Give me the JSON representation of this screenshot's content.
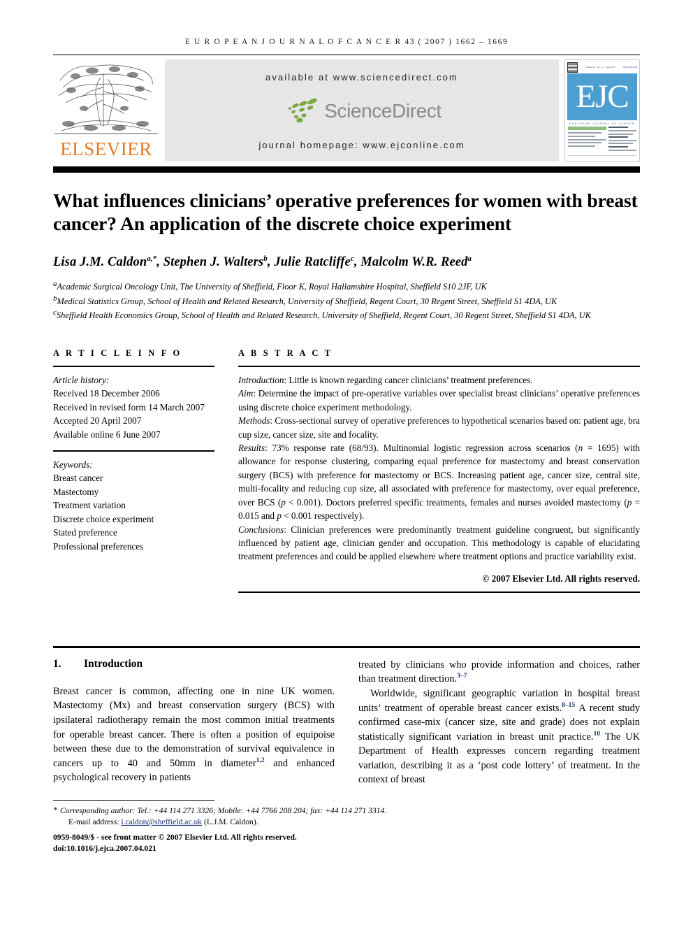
{
  "running_head": {
    "journal": "E U R O P E A N   J O U R N A L   O F   C A N C E R",
    "citation": "43 ( 2007 ) 1662 – 1669",
    "full": "EUROPEAN JOURNAL OF CANCER 43 (2007) 1662–1669"
  },
  "masthead": {
    "publisher_wordmark": "ELSEVIER",
    "available_at": "available at www.sciencedirect.com",
    "sciencedirect_logo_text": "ScienceDirect",
    "journal_homepage": "journal homepage: www.ejconline.com",
    "cover": {
      "acronym": "EJC",
      "subtitle": "EUROPEAN JOURNAL OF CANCER",
      "issue_line": "Volume 43 · No. 11 · June 2007",
      "issn_line": "ISSN 0959-8049",
      "toc_items": [
        "Prognostic markers for prostate cancer",
        "Pain relief assessment in breast",
        "Breast conserving surgery and mastectomy after rtPCR evaluation of recurrence"
      ]
    },
    "colors": {
      "elsevier_orange": "#E87722",
      "band_grey": "#e6e6e6",
      "sciencedirect_green": "#7aa843",
      "sciencedirect_grey": "#8a8a8a",
      "cover_blue": "#4e9fd1"
    }
  },
  "article": {
    "title": "What influences clinicians’ operative preferences for women with breast cancer? An application of the discrete choice experiment",
    "authors_html": "Lisa J.M. Caldon<sup>a,</sup><sup>*</sup>, Stephen J. Walters<sup>b</sup>, Julie Ratcliffe<sup>c</sup>, Malcolm W.R. Reed<sup>a</sup>",
    "affiliations": [
      "Academic Surgical Oncology Unit, The University of Sheffield, Floor K, Royal Hallamshire Hospital, Sheffield S10 2JF, UK",
      "Medical Statistics Group, School of Health and Related Research, University of Sheffield, Regent Court, 30 Regent Street, Sheffield S1 4DA, UK",
      "Sheffield Health Economics Group, School of Health and Related Research, University of Sheffield, Regent Court, 30 Regent Street, Sheffield S1 4DA, UK"
    ],
    "affiliation_markers": [
      "a",
      "b",
      "c"
    ]
  },
  "article_info": {
    "heading": "A R T I C L E   I N F O",
    "history_label": "Article history:",
    "history": [
      "Received 18 December 2006",
      "Received in revised form 14 March 2007",
      "Accepted 20 April 2007",
      "Available online 6 June 2007"
    ],
    "keywords_label": "Keywords:",
    "keywords": [
      "Breast cancer",
      "Mastectomy",
      "Treatment variation",
      "Discrete choice experiment",
      "Stated preference",
      "Professional preferences"
    ]
  },
  "abstract": {
    "heading": "A B S T R A C T",
    "sections": [
      {
        "label": "Introduction",
        "text": "Little is known regarding cancer clinicians’ treatment preferences."
      },
      {
        "label": "Aim",
        "text": "Determine the impact of pre-operative variables over specialist breast clinicians’ operative preferences using discrete choice experiment methodology."
      },
      {
        "label": "Methods",
        "text": "Cross-sectional survey of operative preferences to hypothetical scenarios based on: patient age, bra cup size, cancer size, site and focality."
      },
      {
        "label": "Results",
        "text_html": "73% response rate (68/93). Multinomial logistic regression across scenarios (<i>n</i> = 1695) with allowance for response clustering, comparing equal preference for mastectomy and breast conservation surgery (BCS) with preference for mastectomy or BCS. Increasing patient age, cancer size, central site, multi-focality and reducing cup size, all associated with preference for mastectomy, over equal preference, over BCS (<i>p</i> &lt; 0.001). Doctors preferred specific treatments, females and nurses avoided mastectomy (<i>p</i> = 0.015 and <i>p</i> &lt; 0.001 respectively)."
      },
      {
        "label": "Conclusions",
        "text": "Clinician preferences were predominantly treatment guideline congruent, but significantly influenced by patient age, clinician gender and occupation. This methodology is capable of elucidating treatment preferences and could be applied elsewhere where treatment options and practice variability exist."
      }
    ],
    "copyright": "© 2007 Elsevier Ltd. All rights reserved."
  },
  "body": {
    "section_number": "1.",
    "section_title": "Introduction",
    "left_column_html": "Breast cancer is common, affecting one in nine UK women. Mastectomy (Mx) and breast conservation surgery (BCS) with ipsilateral radiotherapy remain the most common initial treatments for operable breast cancer. There is often a position of equipoise between these due to the demonstration of survival equivalence in cancers up to 40 and 50mm in diameter<sup>1,2</sup> and enhanced psychological recovery in patients",
    "right_column_para1_html": "treated by clinicians who provide information and choices, rather than treatment direction.<sup>3–7</sup>",
    "right_column_para2_html": "Worldwide, significant geographic variation in hospital breast units’ treatment of operable breast cancer exists.<sup>8–15</sup> A recent study confirmed case-mix (cancer size, site and grade) does not explain statistically significant variation in breast unit practice.<sup>10</sup> The UK Department of Health expresses concern regarding treatment variation, describing it as a ‘post code lottery’ of treatment. In the context of breast"
  },
  "footnotes": {
    "corresponding_author": "Corresponding author: Tel.: +44 114 271 3326; Mobile: +44 7766 208 204; fax: +44 114 271 3314.",
    "corresponding_marker": "*",
    "email_label": "E-mail address:",
    "email": "l.caldon@sheffield.ac.uk",
    "email_owner": "(L.J.M. Caldon).",
    "issn_line": "0959-8049/$ - see front matter © 2007 Elsevier Ltd. All rights reserved.",
    "doi_line": "doi:10.1016/j.ejca.2007.04.021",
    "link_color": "#1b2f6e"
  }
}
